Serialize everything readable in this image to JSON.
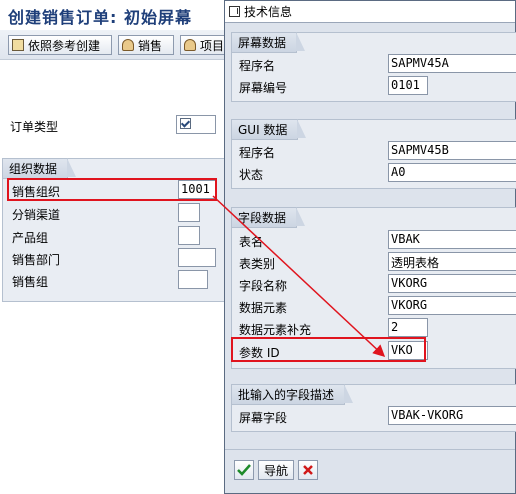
{
  "main": {
    "title": "创建销售订单: 初始屏幕",
    "toolbar": {
      "ref_create_label": "依照参考创建",
      "sales_label": "销售",
      "item_overview_label": "项目"
    },
    "order_type_label": "订单类型",
    "org_group": {
      "title": "组织数据",
      "sales_org_label": "销售组织",
      "sales_org_value": "1001",
      "dist_channel_label": "分销渠道",
      "division_label": "产品组",
      "sales_office_label": "销售部门",
      "sales_group_label": "销售组"
    }
  },
  "popup": {
    "title": "技术信息",
    "screen_data": {
      "title": "屏幕数据",
      "program_label": "程序名",
      "program_value": "SAPMV45A",
      "screen_no_label": "屏幕编号",
      "screen_no_value": "0101"
    },
    "gui_data": {
      "title": "GUI 数据",
      "program_label": "程序名",
      "program_value": "SAPMV45B",
      "status_label": "状态",
      "status_value": "A0"
    },
    "field_data": {
      "title": "字段数据",
      "table_label": "表名",
      "table_value": "VBAK",
      "table_type_label": "表类别",
      "table_type_value": "透明表格",
      "field_name_label": "字段名称",
      "field_name_value": "VKORG",
      "data_element_label": "数据元素",
      "data_element_value": "VKORG",
      "data_element_suppl_label": "数据元素补充",
      "data_element_suppl_value": "2",
      "param_id_label": "参数 ID",
      "param_id_value": "VKO"
    },
    "batch_input": {
      "title": "批输入的字段描述",
      "screen_field_label": "屏幕字段",
      "screen_field_value": "VBAK-VKORG"
    },
    "footer": {
      "navigate_label": "导航"
    }
  },
  "colors": {
    "accent_red": "#e0141e",
    "title_blue": "#1f3f7a",
    "panel_bg": "#dde3ec"
  }
}
